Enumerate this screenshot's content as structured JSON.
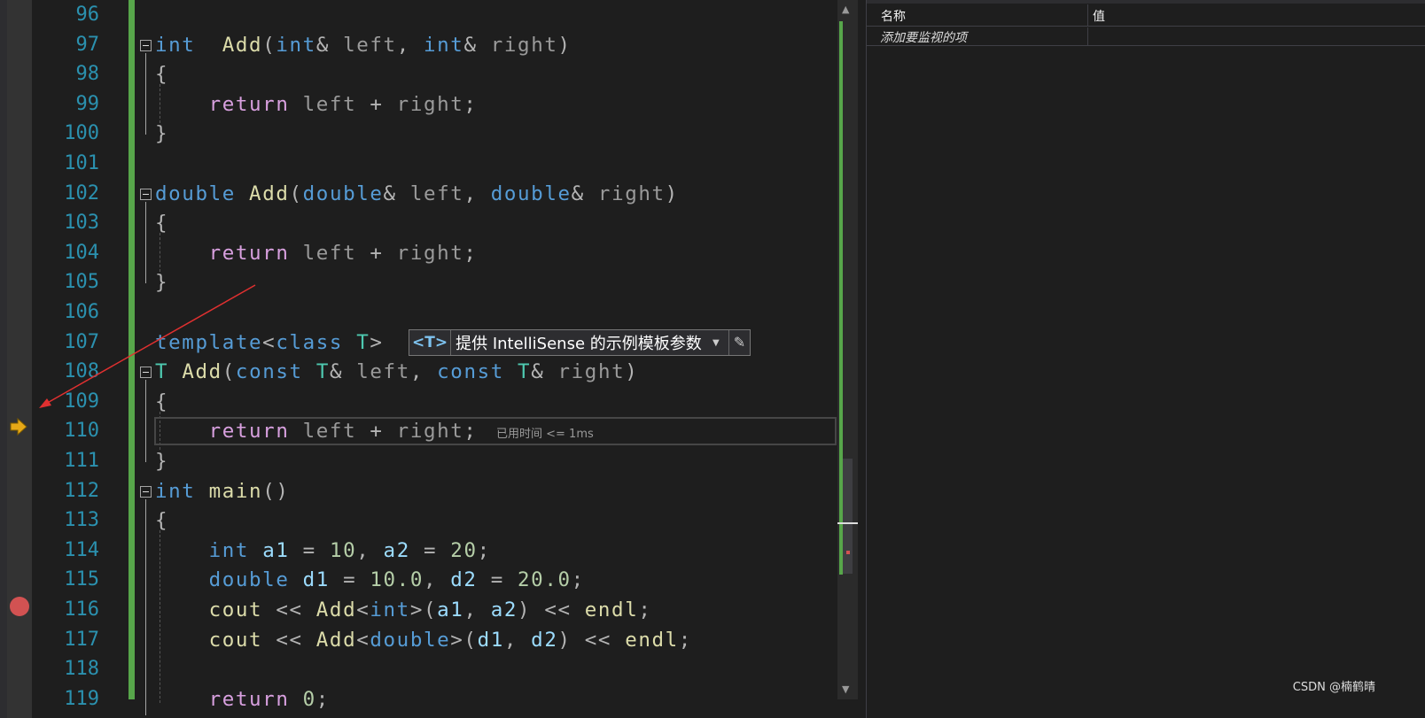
{
  "editor": {
    "lines": [
      {
        "n": "96",
        "tokens": []
      },
      {
        "n": "97",
        "fold": true,
        "tokens": [
          [
            "kw",
            "int"
          ],
          [
            "",
            "  "
          ],
          [
            "fn",
            "Add"
          ],
          [
            "op",
            "("
          ],
          [
            "kw",
            "int"
          ],
          [
            "op",
            "& "
          ],
          [
            "par",
            "left"
          ],
          [
            "op",
            ", "
          ],
          [
            "kw",
            "int"
          ],
          [
            "op",
            "& "
          ],
          [
            "par",
            "right"
          ],
          [
            "op",
            ")"
          ]
        ]
      },
      {
        "n": "98",
        "tokens": [
          [
            "op",
            "{"
          ]
        ]
      },
      {
        "n": "99",
        "tokens": [
          [
            "",
            "    "
          ],
          [
            "ctl",
            "return"
          ],
          [
            "",
            ""
          ],
          [
            "par",
            " left "
          ],
          [
            "op",
            "+"
          ],
          [
            "par",
            " right"
          ],
          [
            "op",
            ";"
          ]
        ]
      },
      {
        "n": "100",
        "tokens": [
          [
            "op",
            "}"
          ]
        ]
      },
      {
        "n": "101",
        "tokens": []
      },
      {
        "n": "102",
        "fold": true,
        "tokens": [
          [
            "kw",
            "double"
          ],
          [
            "",
            " "
          ],
          [
            "fn",
            "Add"
          ],
          [
            "op",
            "("
          ],
          [
            "kw",
            "double"
          ],
          [
            "op",
            "& "
          ],
          [
            "par",
            "left"
          ],
          [
            "op",
            ", "
          ],
          [
            "kw",
            "double"
          ],
          [
            "op",
            "& "
          ],
          [
            "par",
            "right"
          ],
          [
            "op",
            ")"
          ]
        ]
      },
      {
        "n": "103",
        "tokens": [
          [
            "op",
            "{"
          ]
        ]
      },
      {
        "n": "104",
        "tokens": [
          [
            "",
            "    "
          ],
          [
            "ctl",
            "return"
          ],
          [
            "par",
            " left "
          ],
          [
            "op",
            "+"
          ],
          [
            "par",
            " right"
          ],
          [
            "op",
            ";"
          ]
        ]
      },
      {
        "n": "105",
        "tokens": [
          [
            "op",
            "}"
          ]
        ]
      },
      {
        "n": "106",
        "tokens": []
      },
      {
        "n": "107",
        "tokens": [
          [
            "kw",
            "template"
          ],
          [
            "op",
            "<"
          ],
          [
            "kw",
            "class"
          ],
          [
            "",
            " "
          ],
          [
            "tp",
            "T"
          ],
          [
            "op",
            ">"
          ]
        ]
      },
      {
        "n": "108",
        "fold": true,
        "tokens": [
          [
            "tp",
            "T"
          ],
          [
            "",
            " "
          ],
          [
            "fn",
            "Add"
          ],
          [
            "op",
            "("
          ],
          [
            "kw",
            "const"
          ],
          [
            "",
            " "
          ],
          [
            "tp",
            "T"
          ],
          [
            "op",
            "& "
          ],
          [
            "par",
            "left"
          ],
          [
            "op",
            ", "
          ],
          [
            "kw",
            "const"
          ],
          [
            "",
            " "
          ],
          [
            "tp",
            "T"
          ],
          [
            "op",
            "& "
          ],
          [
            "par",
            "right"
          ],
          [
            "op",
            ")"
          ]
        ]
      },
      {
        "n": "109",
        "tokens": [
          [
            "op",
            "{"
          ]
        ]
      },
      {
        "n": "110",
        "tokens": [
          [
            "",
            "    "
          ],
          [
            "ctl",
            "return"
          ],
          [
            "par",
            " left "
          ],
          [
            "op",
            "+"
          ],
          [
            "par",
            " right"
          ],
          [
            "op",
            ";"
          ]
        ]
      },
      {
        "n": "111",
        "tokens": [
          [
            "op",
            "}"
          ]
        ]
      },
      {
        "n": "112",
        "fold": true,
        "tokens": [
          [
            "kw",
            "int"
          ],
          [
            "",
            " "
          ],
          [
            "fn",
            "main"
          ],
          [
            "op",
            "()"
          ]
        ]
      },
      {
        "n": "113",
        "tokens": [
          [
            "op",
            "{"
          ]
        ]
      },
      {
        "n": "114",
        "tokens": [
          [
            "",
            "    "
          ],
          [
            "kw",
            "int"
          ],
          [
            "",
            " "
          ],
          [
            "var",
            "a1"
          ],
          [
            "op",
            " = "
          ],
          [
            "num",
            "10"
          ],
          [
            "op",
            ", "
          ],
          [
            "var",
            "a2"
          ],
          [
            "op",
            " = "
          ],
          [
            "num",
            "20"
          ],
          [
            "op",
            ";"
          ]
        ]
      },
      {
        "n": "115",
        "tokens": [
          [
            "",
            "    "
          ],
          [
            "kw",
            "double"
          ],
          [
            "",
            " "
          ],
          [
            "var",
            "d1"
          ],
          [
            "op",
            " = "
          ],
          [
            "num",
            "10.0"
          ],
          [
            "op",
            ", "
          ],
          [
            "var",
            "d2"
          ],
          [
            "op",
            " = "
          ],
          [
            "num",
            "20.0"
          ],
          [
            "op",
            ";"
          ]
        ]
      },
      {
        "n": "116",
        "tokens": [
          [
            "",
            "    "
          ],
          [
            "fn",
            "cout"
          ],
          [
            "op",
            " << "
          ],
          [
            "fn",
            "Add"
          ],
          [
            "op",
            "<"
          ],
          [
            "kw",
            "int"
          ],
          [
            "op",
            ">("
          ],
          [
            "var",
            "a1"
          ],
          [
            "op",
            ", "
          ],
          [
            "var",
            "a2"
          ],
          [
            "op",
            ") << "
          ],
          [
            "fn",
            "endl"
          ],
          [
            "op",
            ";"
          ]
        ]
      },
      {
        "n": "117",
        "tokens": [
          [
            "",
            "    "
          ],
          [
            "fn",
            "cout"
          ],
          [
            "op",
            " << "
          ],
          [
            "fn",
            "Add"
          ],
          [
            "op",
            "<"
          ],
          [
            "kw",
            "double"
          ],
          [
            "op",
            ">("
          ],
          [
            "var",
            "d1"
          ],
          [
            "op",
            ", "
          ],
          [
            "var",
            "d2"
          ],
          [
            "op",
            ") << "
          ],
          [
            "fn",
            "endl"
          ],
          [
            "op",
            ";"
          ]
        ]
      },
      {
        "n": "118",
        "tokens": []
      },
      {
        "n": "119",
        "tokens": [
          [
            "",
            "    "
          ],
          [
            "ctl",
            "return"
          ],
          [
            "",
            " "
          ],
          [
            "num",
            "0"
          ],
          [
            "op",
            ";"
          ]
        ]
      }
    ],
    "elapsed": "已用时间 <= 1ms",
    "current_line": "110",
    "breakpoint_line": "116",
    "template_tip": {
      "badge": "<T>",
      "label": "提供 IntelliSense 的示例模板参数"
    }
  },
  "watch": {
    "col_name": "名称",
    "col_value": "值",
    "add_item": "添加要监视的项"
  },
  "watermark": "CSDN @楠鹤晴",
  "colors": {
    "keyword": "#569cd6",
    "control": "#d8a0df",
    "function": "#dcdcaa",
    "type_param": "#4ec9b0",
    "breakpoint": "#d25252",
    "current_arrow": "#e6a817"
  }
}
